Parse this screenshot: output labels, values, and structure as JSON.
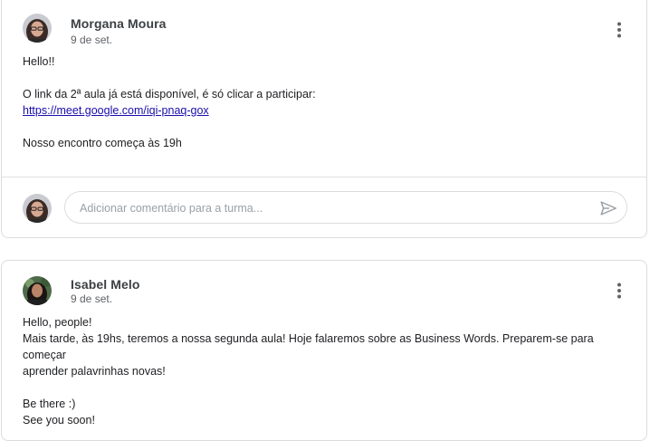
{
  "posts": [
    {
      "author": "Morgana Moura",
      "date": "9 de set.",
      "lines": {
        "greeting": "Hello!!",
        "line1": "O link da 2ª aula já está disponível, é só clicar a participar:",
        "link": "https://meet.google.com/iqi-pnaq-gox",
        "line3": "Nosso encontro começa às 19h"
      },
      "comment_placeholder": "Adicionar comentário para a turma..."
    },
    {
      "author": "Isabel Melo",
      "date": "9 de set.",
      "lines": {
        "line1": "Hello, people!",
        "line2": "Mais tarde, às 19hs, teremos a nossa segunda aula! Hoje falaremos sobre as Business Words. Preparem-se para começar",
        "line3": "aprender palavrinhas novas!",
        "line4": "Be there :)",
        "line5": "See you soon!"
      }
    }
  ],
  "colors": {
    "border": "#dadce0",
    "link": "#1a0dab",
    "secondary_text": "#5f6368",
    "icon": "#5f6368"
  },
  "icons": {
    "menu": "more-vert-icon",
    "send": "send-icon"
  }
}
